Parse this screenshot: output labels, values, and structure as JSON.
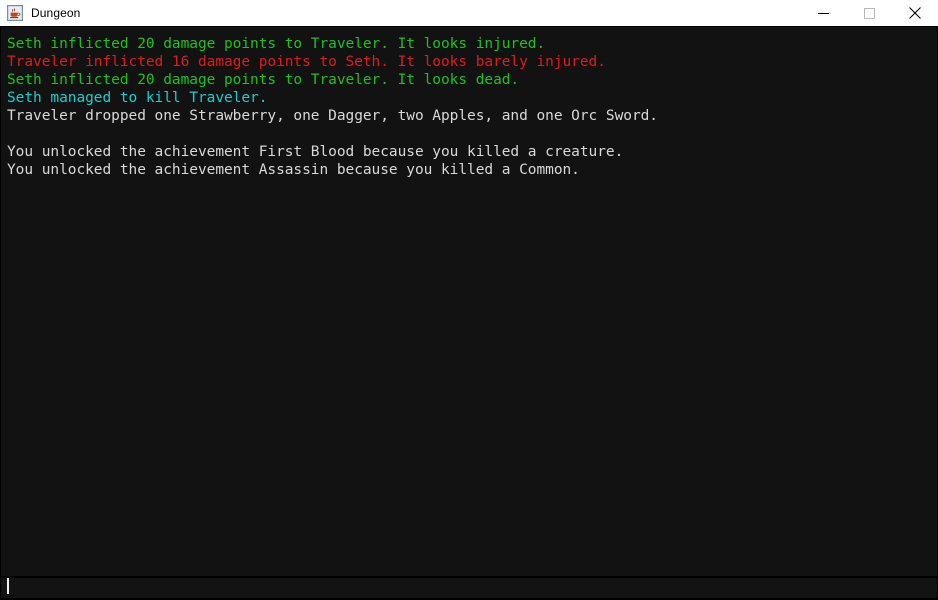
{
  "window": {
    "title": "Dungeon",
    "app_icon": "java-coffee-cup-icon",
    "controls": {
      "minimize": "Minimize",
      "maximize": "Maximize",
      "close": "Close"
    }
  },
  "colors": {
    "background": "#121212",
    "title_bar": "#ffffff",
    "green": "#20c020",
    "red": "#e01b1b",
    "cyan": "#19cfd0",
    "default_text": "#d8d8d8",
    "input_background": "#131313",
    "caret": "#f2f2f2"
  },
  "console": {
    "lines": [
      {
        "text": "Seth inflicted 20 damage points to Traveler. It looks injured.",
        "color": "#20c020"
      },
      {
        "text": "Traveler inflicted 16 damage points to Seth. It looks barely injured.",
        "color": "#e01b1b"
      },
      {
        "text": "Seth inflicted 20 damage points to Traveler. It looks dead.",
        "color": "#20c020"
      },
      {
        "text": "Seth managed to kill Traveler.",
        "color": "#19cfd0"
      },
      {
        "text": "Traveler dropped one Strawberry, one Dagger, two Apples, and one Orc Sword.",
        "color": "#d8d8d8"
      },
      {
        "text": "",
        "color": "#d8d8d8"
      },
      {
        "text": "You unlocked the achievement First Blood because you killed a creature.",
        "color": "#d8d8d8"
      },
      {
        "text": "You unlocked the achievement Assassin because you killed a Common.",
        "color": "#d8d8d8"
      }
    ]
  },
  "input": {
    "value": "",
    "placeholder": ""
  }
}
